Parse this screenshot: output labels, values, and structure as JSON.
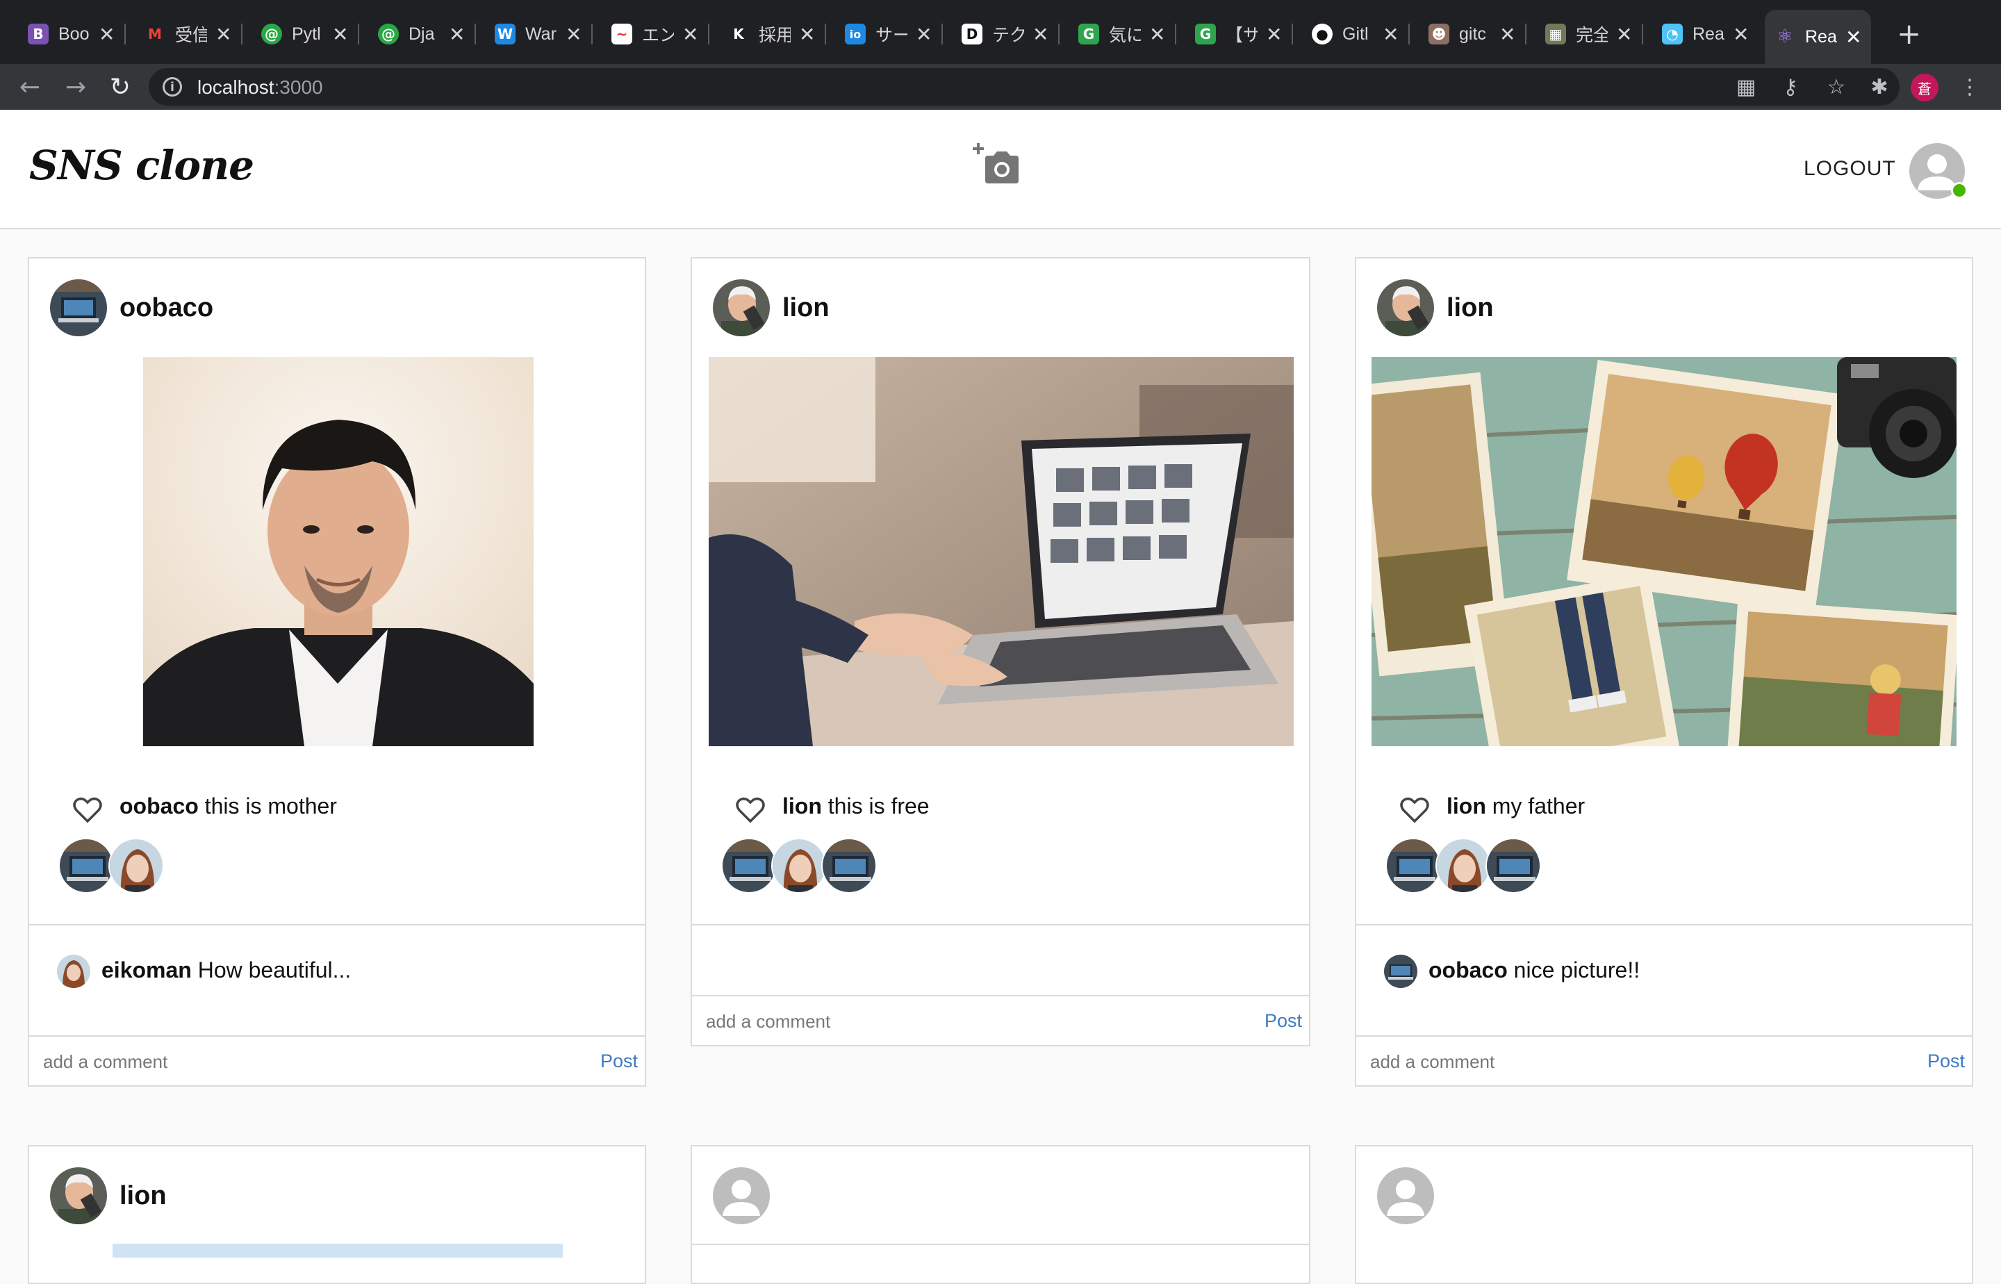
{
  "browser": {
    "tabs": [
      {
        "label": "Boo",
        "icon": "bootstrap-icon",
        "color": "#7952b3",
        "glyph": "B"
      },
      {
        "label": "受信",
        "icon": "gmail-icon",
        "color": "#1f2023",
        "glyph": "M"
      },
      {
        "label": "Pytl",
        "icon": "circle-green-icon",
        "color": "#27a844",
        "glyph": "@"
      },
      {
        "label": "Dja",
        "icon": "circle-green-icon",
        "color": "#27a844",
        "glyph": "@"
      },
      {
        "label": "War",
        "icon": "w-icon",
        "color": "#1e88e5",
        "glyph": "W"
      },
      {
        "label": "エン",
        "icon": "wave-icon",
        "color": "#ffffff",
        "glyph": "~"
      },
      {
        "label": "採用",
        "icon": "k-icon",
        "color": "#1f2023",
        "glyph": "K"
      },
      {
        "label": "サー",
        "icon": "io-icon",
        "color": "#1e88e5",
        "glyph": "io"
      },
      {
        "label": "テク",
        "icon": "d-icon",
        "color": "#ffffff",
        "glyph": "D"
      },
      {
        "label": "気に",
        "icon": "g-icon",
        "color": "#2ea44f",
        "glyph": "G"
      },
      {
        "label": "【サ",
        "icon": "g-icon",
        "color": "#2ea44f",
        "glyph": "G"
      },
      {
        "label": "Gitl",
        "icon": "github-icon",
        "color": "#1f2023",
        "glyph": "●"
      },
      {
        "label": "gitc",
        "icon": "avatar-icon",
        "color": "#8d6e63",
        "glyph": "☻"
      },
      {
        "label": "完全",
        "icon": "photo-icon",
        "color": "#6d7b5a",
        "glyph": "▦"
      },
      {
        "label": "Rea",
        "icon": "react-icon",
        "color": "#4fc3f7",
        "glyph": "◔"
      },
      {
        "label": "Rea",
        "icon": "react-icon",
        "color": "#7c4dff",
        "glyph": "⚛"
      }
    ],
    "new_tab": "+",
    "url_host": "localhost",
    "url_port": ":3000",
    "profile_initial": "蒼"
  },
  "header": {
    "logo": "SNS clone",
    "logout": "LOGOUT"
  },
  "posts": [
    {
      "username": "oobaco",
      "caption_user": "oobaco",
      "caption_text": " this is mother",
      "likes": 2,
      "comment_user": "eikoman",
      "comment_text": " How beautiful...",
      "placeholder": "add a comment",
      "post_label": "Post"
    },
    {
      "username": "lion",
      "caption_user": "lion",
      "caption_text": " this is free",
      "likes": 3,
      "comment_user": "",
      "comment_text": "",
      "placeholder": "add a comment",
      "post_label": "Post"
    },
    {
      "username": "lion",
      "caption_user": "lion",
      "caption_text": " my father",
      "likes": 3,
      "comment_user": "oobaco",
      "comment_text": " nice picture!!",
      "placeholder": "add a comment",
      "post_label": "Post"
    },
    {
      "username": "lion"
    },
    {
      "username": ""
    },
    {
      "username": ""
    }
  ],
  "colors": {
    "accent": "#3f7bbf",
    "online": "#44b700",
    "border": "#dbdbdb"
  }
}
